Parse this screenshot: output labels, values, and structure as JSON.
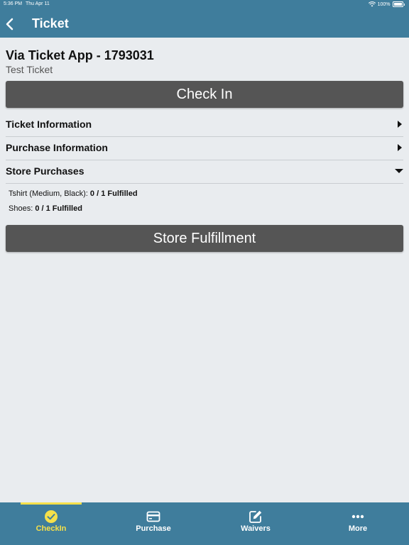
{
  "status": {
    "time": "5:36 PM",
    "date": "Thu Apr 11",
    "battery": "100%"
  },
  "nav": {
    "title": "Ticket"
  },
  "ticket": {
    "title": "Via Ticket App - 1793031",
    "subtitle": "Test Ticket"
  },
  "buttons": {
    "check_in": "Check In",
    "store_fulfillment": "Store Fulfillment"
  },
  "sections": [
    {
      "label": "Ticket Information",
      "expanded": false
    },
    {
      "label": "Purchase Information",
      "expanded": false
    },
    {
      "label": "Store Purchases",
      "expanded": true
    }
  ],
  "store_items": [
    {
      "name": "Tshirt (Medium, Black):",
      "status": "0 / 1 Fulfilled"
    },
    {
      "name": "Shoes:",
      "status": "0 / 1 Fulfilled"
    }
  ],
  "tabs": [
    {
      "label": "CheckIn",
      "icon": "check-circle-icon",
      "active": true
    },
    {
      "label": "Purchase",
      "icon": "credit-card-icon",
      "active": false
    },
    {
      "label": "Waivers",
      "icon": "edit-icon",
      "active": false
    },
    {
      "label": "More",
      "icon": "more-dots-icon",
      "active": false
    }
  ],
  "colors": {
    "header": "#3f7d9c",
    "button": "#555555",
    "active_tab": "#f5e04a"
  }
}
